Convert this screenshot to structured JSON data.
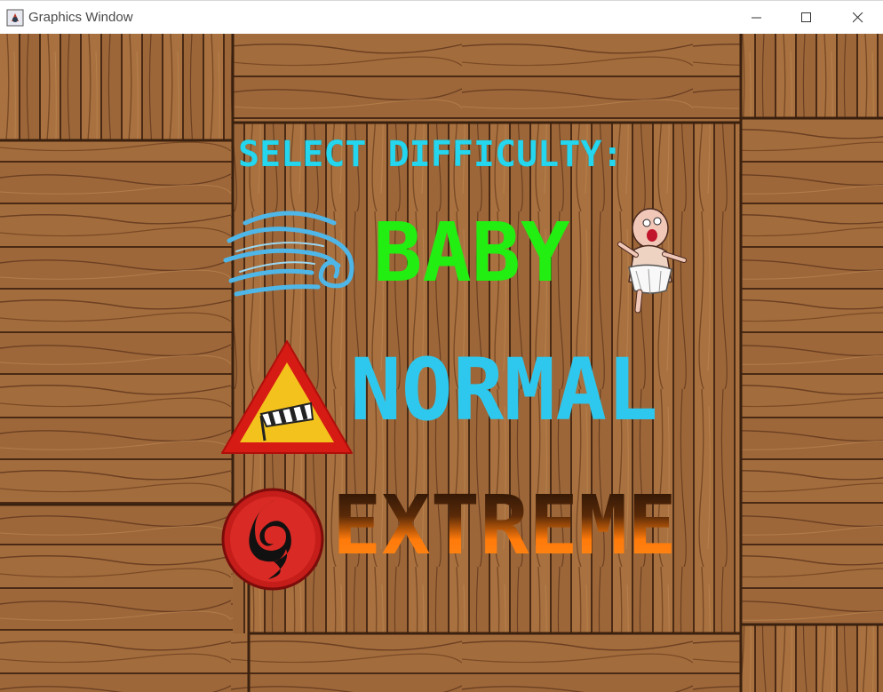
{
  "window": {
    "title": "Graphics Window",
    "app_icon": "java-icon",
    "controls": [
      "minimize-icon",
      "maximize-icon",
      "close-icon"
    ]
  },
  "screen": {
    "heading": "SELECT DIFFICULTY:",
    "options": [
      {
        "label": "BABY",
        "icon_left": "wind-gust-icon",
        "icon_right": "baby-diaper-icon"
      },
      {
        "label": "NORMAL",
        "icon_left": "windsock-warning-sign-icon"
      },
      {
        "label": "EXTREME",
        "icon_left": "hurricane-symbol-icon"
      }
    ]
  },
  "colors": {
    "title": "#24d6ee",
    "baby": "#22ee11",
    "normal": "#2ec8ee",
    "extreme_top": "#1a0d05",
    "extreme_bottom": "#ff7a0a",
    "wood_dark": "#6b3f22",
    "wood_light": "#a8713f"
  }
}
